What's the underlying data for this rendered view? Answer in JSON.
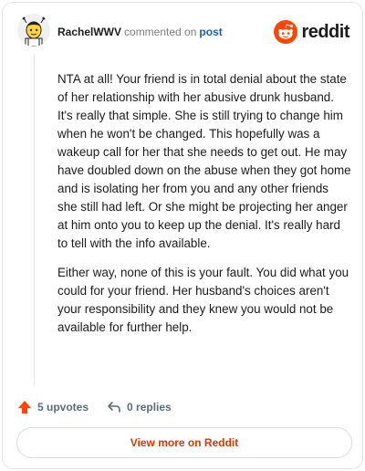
{
  "comment": {
    "username": "RachelWWV",
    "action_text": "commented on",
    "post_link": "post",
    "paragraphs": [
      "NTA at all! Your friend is in total denial about the state of her relationship with her abusive drunk husband. It's really that simple. She is still trying to change him when he won't be changed. This hopefully was a wakeup call for her that she needs to get out. He may have doubled down on the abuse when they got home and is isolating her from you and any other friends she still had left. Or she might be projecting her anger at him onto you to keep up the denial. It's really hard to tell with the info available.",
      "Either way, none of this is your fault. You did what you could for your friend. Her husband's choices aren't your responsibility and they knew you would not be available for further help."
    ]
  },
  "brand": {
    "wordmark": "reddit",
    "icon": "reddit-snoo-icon",
    "color": "#ff4500"
  },
  "actions": {
    "upvotes": "5 upvotes",
    "replies": "0 replies",
    "upvote_icon": "upvote-arrow-icon",
    "reply_icon": "reply-arrow-icon",
    "upvote_color": "#ff4500"
  },
  "footer": {
    "view_more": "View more on Reddit",
    "link_color": "#d93900"
  }
}
